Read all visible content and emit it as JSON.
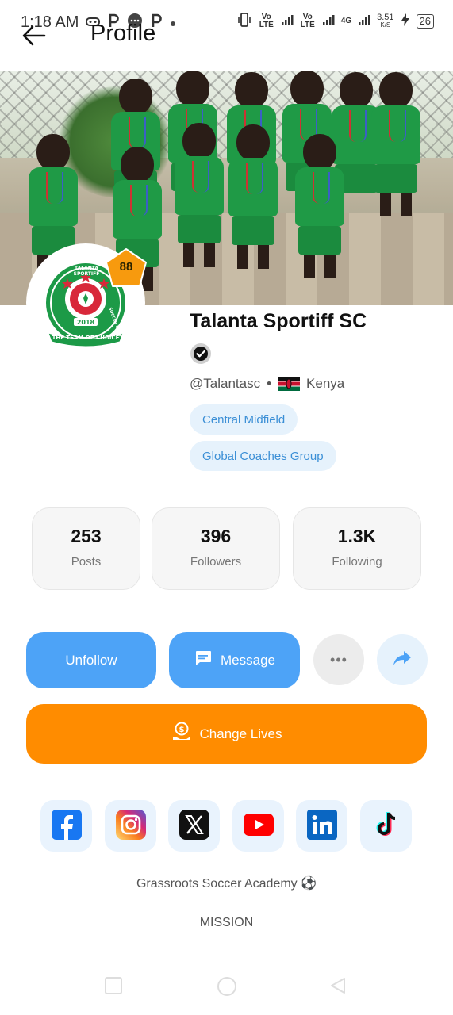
{
  "status_bar": {
    "time": "1:18 AM",
    "left_icons": [
      "game-controller-icon",
      "p-icon",
      "more-icon",
      "p-icon",
      "dot-icon"
    ],
    "network_1": "Vo LTE",
    "network_2": "Vo LTE",
    "network_3": "4G",
    "speed": "3.51",
    "speed_unit": "K/S",
    "battery": "26"
  },
  "header": {
    "title": "Profile",
    "back_icon": "arrow-left-icon"
  },
  "profile": {
    "rating": "88",
    "name": "Talanta Sportiff SC",
    "handle": "@Talantasc",
    "separator": "•",
    "country": "Kenya",
    "tags": [
      "Central Midfield",
      "Global Coaches Group"
    ],
    "logo": {
      "ring_text_top": "TALANTA SPORTIFF",
      "ring_text_side": "SOCCER CLUB",
      "year": "2018",
      "motto": "THE TEAM OF CHOICE"
    }
  },
  "stats": [
    {
      "value": "253",
      "label": "Posts"
    },
    {
      "value": "396",
      "label": "Followers"
    },
    {
      "value": "1.3K",
      "label": "Following"
    }
  ],
  "actions": {
    "unfollow": "Unfollow",
    "message": "Message",
    "more": "•••",
    "donate": "Change Lives"
  },
  "social": [
    "facebook-icon",
    "instagram-icon",
    "x-icon",
    "youtube-icon",
    "linkedin-icon",
    "tiktok-icon"
  ],
  "bio": {
    "tagline": "Grassroots Soccer Academy ⚽",
    "section": "MISSION"
  },
  "colors": {
    "primary_blue": "#4da3f7",
    "orange": "#ff8c00",
    "chip_bg": "#e6f2fc",
    "chip_text": "#3b8fd6"
  }
}
